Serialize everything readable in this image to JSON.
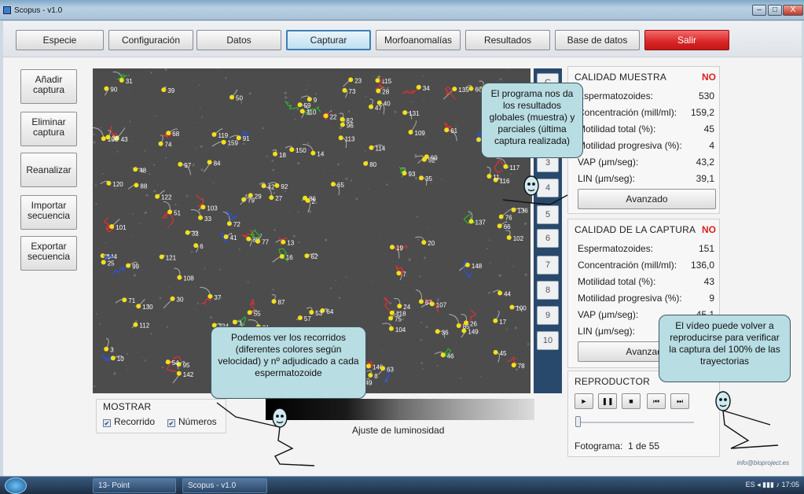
{
  "window": {
    "title": "Scopus - v1.0",
    "min": "–",
    "max": "□",
    "close": "X"
  },
  "toolbar": {
    "tabs": [
      "Especie",
      "Configuración",
      "Datos",
      "Capturar",
      "Morfoanomalías",
      "Resultados",
      "Base de datos",
      "Salir"
    ],
    "active": "Capturar"
  },
  "left_buttons": [
    "Añadir captura",
    "Eliminar captura",
    "Reanalizar",
    "Importar secuencia",
    "Exportar secuencia"
  ],
  "capture_numbers": [
    "C",
    "1",
    "2",
    "3",
    "4",
    "5",
    "6",
    "7",
    "8",
    "9",
    "10"
  ],
  "video": {
    "track_labels": [
      "146",
      "149",
      "150",
      "148",
      "145",
      "144",
      "142",
      "138",
      "136",
      "135",
      "130",
      "121",
      "137",
      "159",
      "124",
      "123",
      "131",
      "122",
      "129",
      "119",
      "120",
      "117",
      "114",
      "116",
      "118",
      "115",
      "113",
      "110",
      "112",
      "109",
      "107",
      "108",
      "104",
      "99",
      "106",
      "102",
      "103",
      "97",
      "100",
      "101",
      "96",
      "95",
      "93",
      "92",
      "90",
      "85",
      "84",
      "87",
      "91",
      "86",
      "88",
      "89",
      "82",
      "79",
      "78",
      "76",
      "75",
      "77",
      "73",
      "71",
      "70",
      "74",
      "80",
      "72",
      "66",
      "62",
      "61",
      "64",
      "67",
      "68",
      "69",
      "65",
      "59",
      "58",
      "57",
      "55",
      "56",
      "60",
      "63",
      "54",
      "52",
      "51",
      "53",
      "50",
      "49",
      "47",
      "48",
      "46",
      "45",
      "44",
      "43",
      "42",
      "40",
      "41",
      "39",
      "38",
      "37",
      "36",
      "35",
      "34",
      "33",
      "32",
      "31",
      "30",
      "29",
      "28",
      "27",
      "26",
      "25",
      "24",
      "23",
      "22",
      "21",
      "20",
      "19",
      "18",
      "17",
      "16",
      "15",
      "14",
      "13",
      "12",
      "11",
      "10",
      "9",
      "8",
      "7",
      "6",
      "5",
      "4",
      "3",
      "2",
      "1"
    ]
  },
  "calidad_muestra": {
    "title": "CALIDAD MUESTRA",
    "status": "NO",
    "rows": [
      {
        "label": "Espermatozoides:",
        "value": "530"
      },
      {
        "label": "Concentración  (mill/ml):",
        "value": "159,2"
      },
      {
        "label": "Motilidad total (%):",
        "value": "45"
      },
      {
        "label": "Motilidad progresiva (%):",
        "value": "4"
      },
      {
        "label": "VAP (μm/seg):",
        "value": "43,2"
      },
      {
        "label": "LIN (μm/seg):",
        "value": "39,1"
      }
    ],
    "advanced_label": "Avanzado"
  },
  "calidad_captura": {
    "title": "CALIDAD DE LA CAPTURA",
    "status": "NO",
    "rows": [
      {
        "label": "Espermatozoides:",
        "value": "151"
      },
      {
        "label": "Concentración (mill/ml):",
        "value": "136,0"
      },
      {
        "label": "Motilidad total (%):",
        "value": "43"
      },
      {
        "label": "Motilidad progresiva (%):",
        "value": "9"
      },
      {
        "label": "VAP (μm/seg):",
        "value": "45,1"
      },
      {
        "label": "LIN (μm/seg):",
        "value": ""
      }
    ],
    "advanced_label": "Avanzado"
  },
  "reproductor": {
    "title": "REPRODUCTOR",
    "buttons": [
      "►",
      "❚❚",
      "■",
      "⏮",
      "⏭"
    ],
    "frame_label": "Fotograma:",
    "frame_value": "1 de 55"
  },
  "mostrar": {
    "title": "MOSTRAR",
    "recorrido": "Recorrido",
    "numeros": "Números"
  },
  "luminosity_label": "Ajuste de luminosidad",
  "callouts": {
    "top": "El programa nos da los resultados globales (muestra) y parciales (última captura realizada)",
    "bottom": "Podemos ver los  recorridos (diferentes colores según velocidad) y nº adjudicado a cada espermatozoide",
    "right": "El vídeo puede volver a reproducirse para verificar la captura del 100% de las trayectorias"
  },
  "footer_email": "info@bioproject.es",
  "taskbar": {
    "tasks": [
      "13- Point",
      "Scopus - v1.0"
    ],
    "tray": "ES  ◂  ▮▮▮  ♪  17:05"
  },
  "colors": {
    "accent_blue": "#3d7fb4",
    "status_no": "#e02020",
    "callout_fill": "#b8dde3",
    "track_red": "#e03030",
    "track_green": "#2fb42f",
    "track_blue": "#3050d0",
    "point_yellow": "#f2e01a"
  }
}
